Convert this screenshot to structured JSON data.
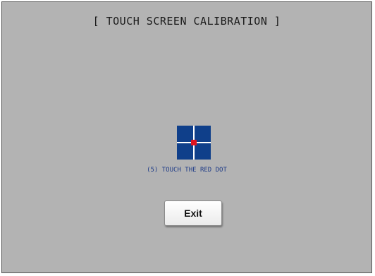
{
  "screen": {
    "title": "[ TOUCH SCREEN CALIBRATION ]",
    "background_color": "#b3b3b3"
  },
  "calibration": {
    "target_icon": "crosshair-target-icon",
    "target_color": "#0f3f8a",
    "dot_color": "#e0141e",
    "instruction": "(5) TOUCH THE RED DOT"
  },
  "buttons": {
    "exit_label": "Exit"
  }
}
